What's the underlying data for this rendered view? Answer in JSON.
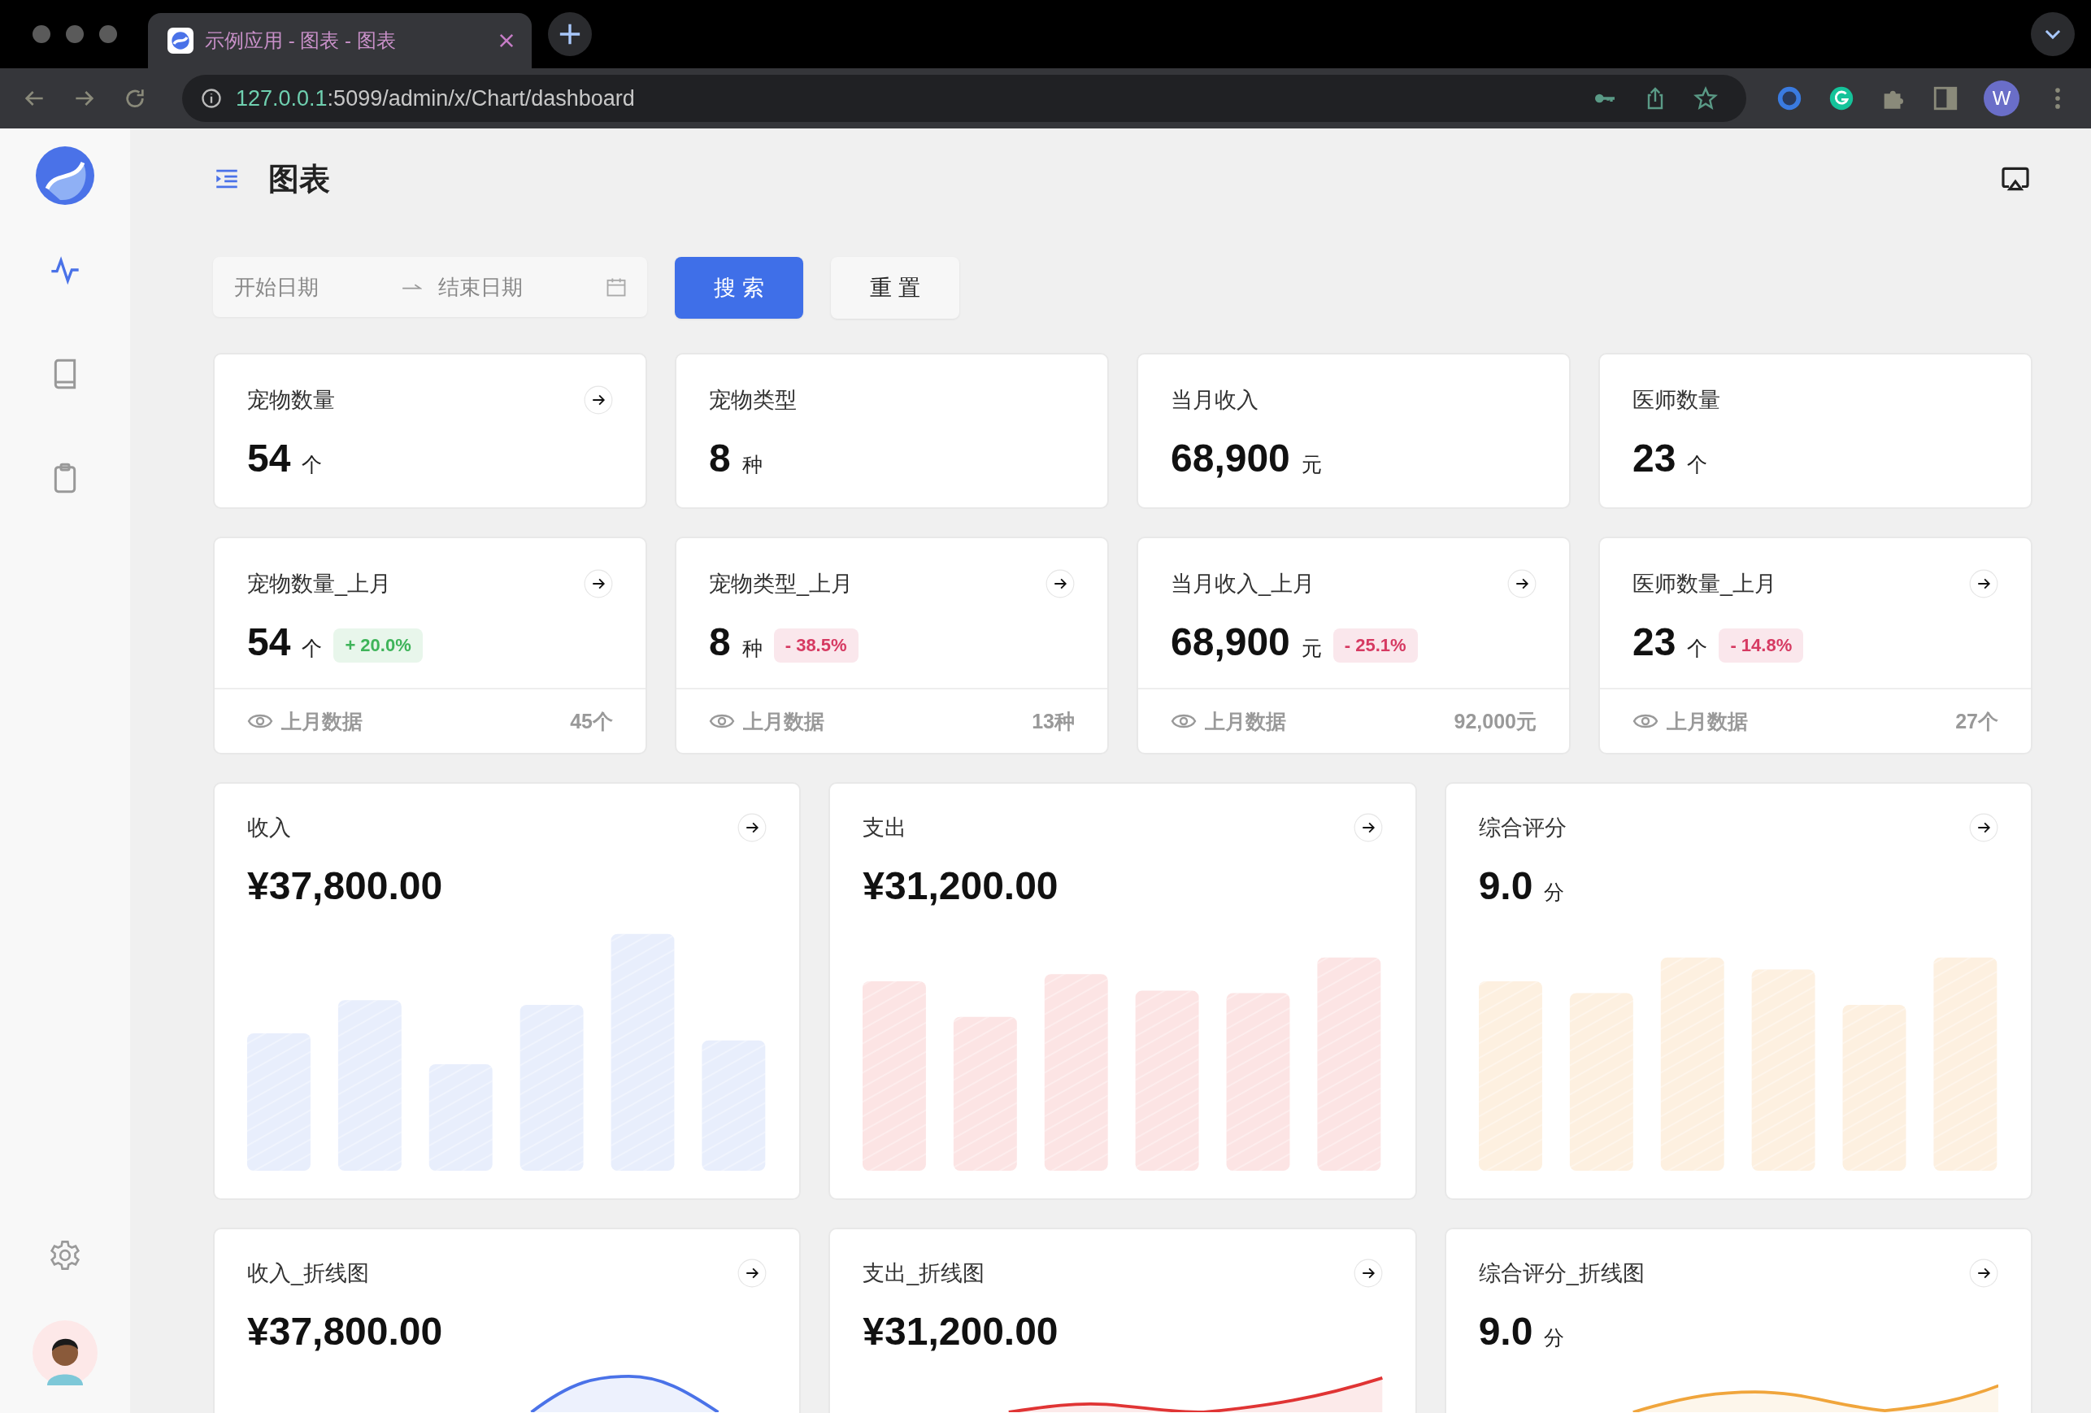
{
  "browser": {
    "tab_title": "示例应用 - 图表 - 图表",
    "url_host": "127.0.0.1",
    "url_path": ":5099/admin/x/Chart/dashboard",
    "profile_initial": "W"
  },
  "sidebar": {
    "items": [
      {
        "selected": true
      },
      {
        "selected": false
      },
      {
        "selected": false
      }
    ]
  },
  "page_title": "图表",
  "filter": {
    "start_placeholder": "开始日期",
    "end_placeholder": "结束日期",
    "search_button": "搜 索",
    "reset_button": "重 置"
  },
  "stats": [
    {
      "title": "宠物数量",
      "value": "54",
      "unit": "个",
      "link": true
    },
    {
      "title": "宠物类型",
      "value": "8",
      "unit": "种",
      "link": false
    },
    {
      "title": "当月收入",
      "value": "68,900",
      "unit": "元",
      "link": false
    },
    {
      "title": "医师数量",
      "value": "23",
      "unit": "个",
      "link": false
    }
  ],
  "compare_stats": [
    {
      "title": "宠物数量_上月",
      "value": "54",
      "unit": "个",
      "change": "+ 20.0%",
      "color": "#3fb45a",
      "footer_label": "上月数据",
      "footer_value": "45个"
    },
    {
      "title": "宠物类型_上月",
      "value": "8",
      "unit": "种",
      "change": "- 38.5%",
      "color": "#d63a62",
      "footer_label": "上月数据",
      "footer_value": "13种"
    },
    {
      "title": "当月收入_上月",
      "value": "68,900",
      "unit": "元",
      "change": "- 25.1%",
      "color": "#d63a62",
      "footer_label": "上月数据",
      "footer_value": "92,000元"
    },
    {
      "title": "医师数量_上月",
      "value": "23",
      "unit": "个",
      "change": "- 14.8%",
      "color": "#d63a62",
      "footer_label": "上月数据",
      "footer_value": "27个"
    }
  ],
  "bar_charts": [
    {
      "title": "收入",
      "value": "¥37,800.00",
      "color": "#e8eefc"
    },
    {
      "title": "支出",
      "value": "¥31,200.00",
      "color": "#fce4e4"
    },
    {
      "title": "综合评分",
      "value": "9.0",
      "unit": "分",
      "color": "#fdf0e0"
    }
  ],
  "line_charts": [
    {
      "title": "收入_折线图",
      "value": "¥37,800.00",
      "color": "#4a72e8"
    },
    {
      "title": "支出_折线图",
      "value": "¥31,200.00",
      "color": "#e03434"
    },
    {
      "title": "综合评分_折线图",
      "value": "9.0",
      "unit": "分",
      "color": "#f0a53c"
    }
  ]
}
